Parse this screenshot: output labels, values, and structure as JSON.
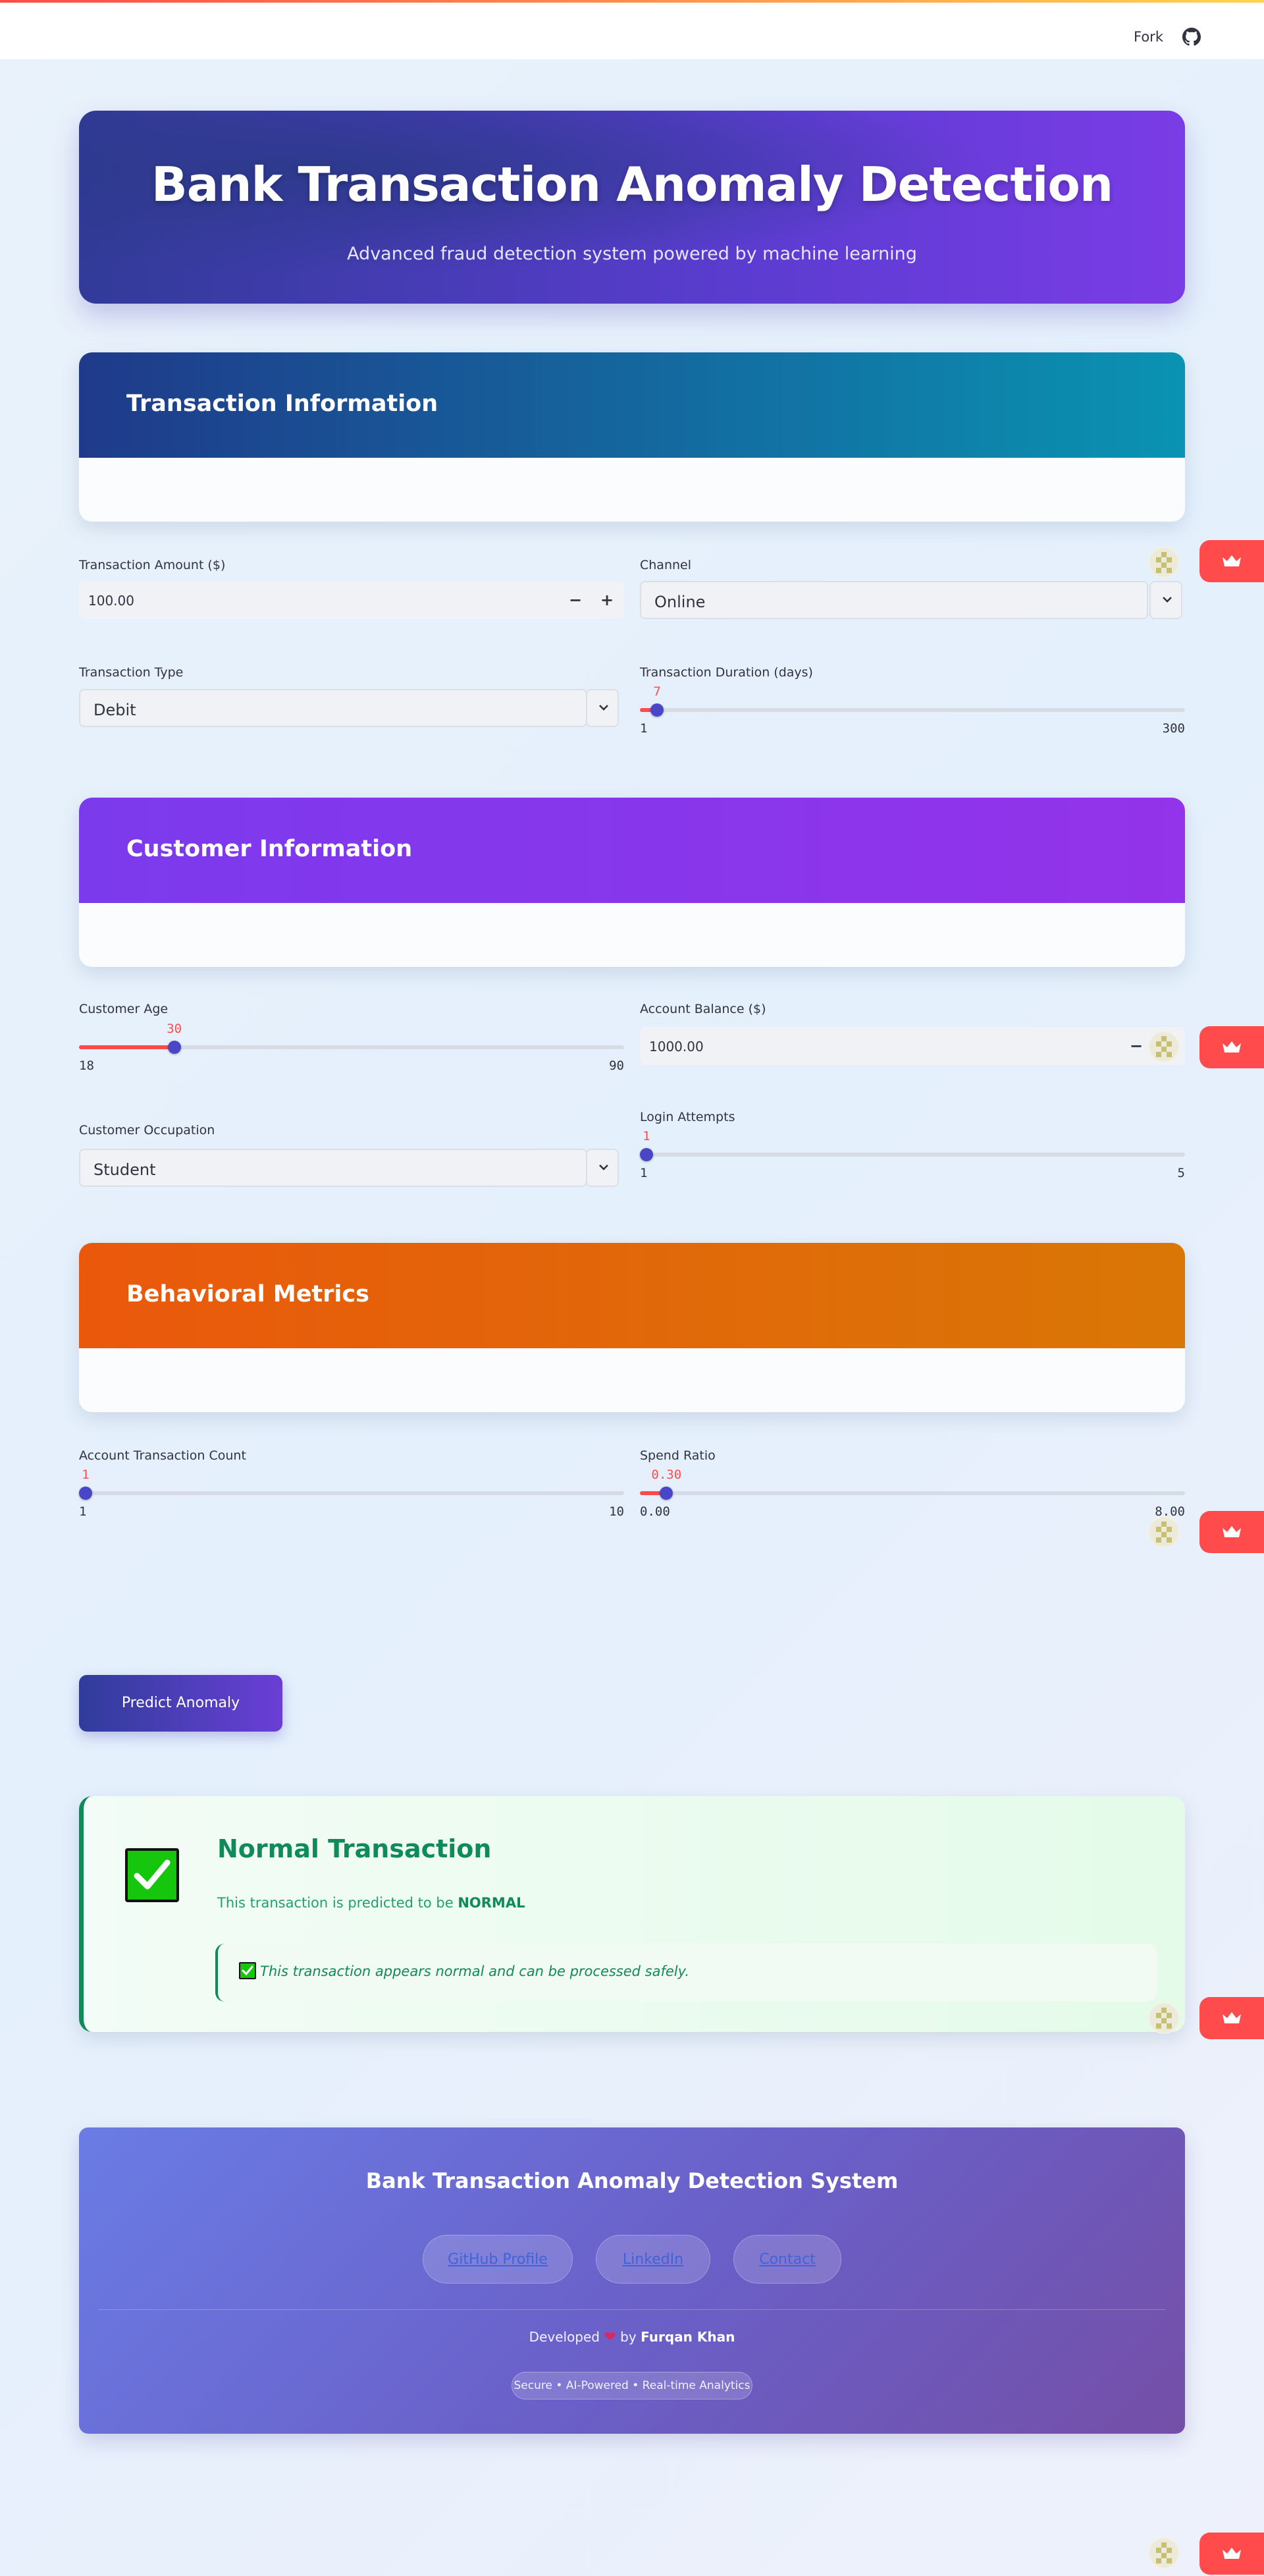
{
  "topbar": {
    "fork_label": "Fork",
    "icon": "github-icon"
  },
  "hero": {
    "title": "Bank Transaction Anomaly Detection",
    "subtitle": "Advanced fraud detection system powered by machine learning"
  },
  "sections": {
    "transaction": {
      "title": "Transaction Information"
    },
    "customer": {
      "title": "Customer Information"
    },
    "behavioral": {
      "title": "Behavioral Metrics"
    }
  },
  "fields": {
    "transaction_amount": {
      "label": "Transaction Amount ($)",
      "value": "100.00",
      "minus": "−",
      "plus": "+"
    },
    "channel": {
      "label": "Channel",
      "value": "Online"
    },
    "transaction_type": {
      "label": "Transaction Type",
      "value": "Debit"
    },
    "transaction_duration": {
      "label": "Transaction Duration (days)",
      "value": "7",
      "min": "1",
      "max": "300",
      "fraction": 0.02
    },
    "customer_age": {
      "label": "Customer Age",
      "value": "30",
      "min": "18",
      "max": "90",
      "fraction": 0.1667
    },
    "account_balance": {
      "label": "Account Balance ($)",
      "value": "1000.00",
      "minus": "−"
    },
    "customer_occupation": {
      "label": "Customer Occupation",
      "value": "Student"
    },
    "login_attempts": {
      "label": "Login Attempts",
      "value": "1",
      "min": "1",
      "max": "5",
      "fraction": 0.0
    },
    "account_transaction_count": {
      "label": "Account Transaction Count",
      "value": "1",
      "min": "1",
      "max": "10",
      "fraction": 0.0
    },
    "spend_ratio": {
      "label": "Spend Ratio",
      "value": "0.30",
      "min": "0.00",
      "max": "8.00",
      "fraction": 0.0375
    }
  },
  "predict_button": {
    "label": "Predict Anomaly"
  },
  "result": {
    "title": "Normal Transaction",
    "text_prefix": "This transaction is predicted to be ",
    "text_strong": "NORMAL",
    "note": "This transaction appears normal and can be processed safely."
  },
  "footer": {
    "title": "Bank Transaction Anomaly Detection System",
    "links": [
      "GitHub Profile",
      "LinkedIn",
      "Contact"
    ],
    "developed_prefix": "Developed",
    "developed_by": "by",
    "author": "Furqan Khan",
    "tagline": "Secure • AI-Powered • Real-time Analytics"
  },
  "colors": {
    "accent": "#ff4b4b",
    "slider_thumb": "#4a46c8",
    "success": "#0f8a59",
    "transaction_header": [
      "#1f3a8a",
      "#0a93b2"
    ],
    "customer_header": [
      "#7c3aed",
      "#9333ea"
    ],
    "behavioral_header": [
      "#ea580c",
      "#d97706"
    ]
  }
}
